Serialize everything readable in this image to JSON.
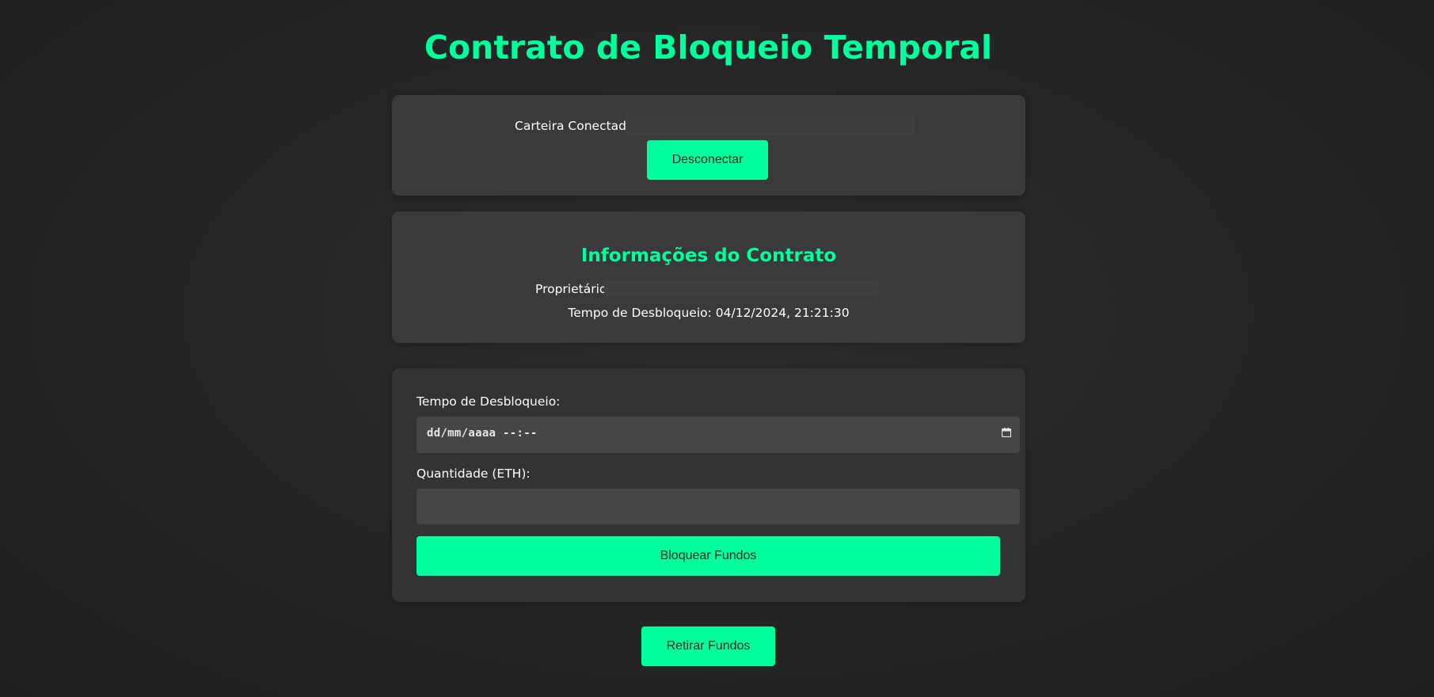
{
  "page": {
    "title": "Contrato de Bloqueio Temporal"
  },
  "wallet": {
    "label": "Carteira Conectada:",
    "address": "",
    "disconnect_label": "Desconectar"
  },
  "contract_info": {
    "title": "Informações do Contrato",
    "owner_label": "Proprietário:",
    "owner_value": "",
    "unlock_label": "Tempo de Desbloqueio:",
    "unlock_value": "04/12/2024, 21:21:30"
  },
  "lock_form": {
    "unlock_time_label": "Tempo de Desbloqueio:",
    "unlock_time_value": "",
    "unlock_time_placeholder": "dd/mm/aaaa --:--",
    "amount_label": "Quantidade (ETH):",
    "amount_value": "",
    "lock_button_label": "Bloquear Fundos"
  },
  "withdraw": {
    "button_label": "Retirar Fundos"
  },
  "icons": {
    "date_picker": "calendar-icon"
  },
  "colors": {
    "accent": "#00ff9d",
    "background": "#252525",
    "card": "#3a3a3a",
    "input": "#464646",
    "text": "#ffffff"
  }
}
